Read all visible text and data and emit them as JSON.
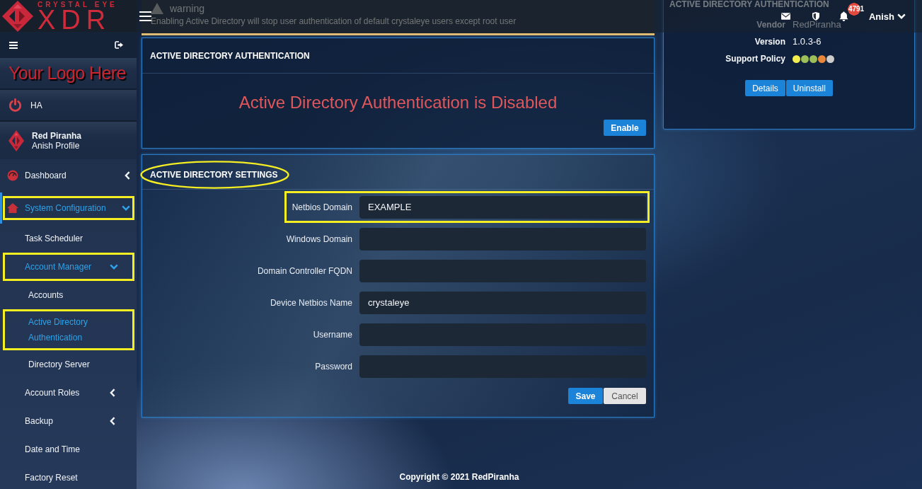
{
  "logo": {
    "tagline": "CRYSTAL EYE",
    "wordmark": "XDR"
  },
  "header": {
    "notification_count": "4791",
    "user": "Anish"
  },
  "sidebar": {
    "custom_logo": "Your Logo Here",
    "ha_label": "HA",
    "profile": {
      "name": "Red Piranha",
      "subtitle": "Anish Profile"
    },
    "items": [
      {
        "label": "Dashboard",
        "selected": false,
        "highlighted": false,
        "expanded": false
      },
      {
        "label": "System Configuration",
        "selected": true,
        "highlighted": true,
        "expanded": true,
        "children": [
          {
            "label": "Task Scheduler",
            "selected": false,
            "highlighted": false
          },
          {
            "label": "Account Manager",
            "selected": true,
            "highlighted": true,
            "expanded": true,
            "children": [
              {
                "label": "Accounts",
                "selected": false,
                "highlighted": false
              },
              {
                "label": "Active Directory Authentication",
                "selected": true,
                "highlighted": true
              },
              {
                "label": "Directory Server",
                "selected": false,
                "highlighted": false
              }
            ]
          },
          {
            "label": "Account Roles",
            "selected": false,
            "highlighted": false,
            "expanded": false
          },
          {
            "label": "Backup",
            "selected": false,
            "highlighted": false,
            "expanded": false
          },
          {
            "label": "Date and Time",
            "selected": false,
            "highlighted": false
          },
          {
            "label": "Factory Reset",
            "selected": false,
            "highlighted": false
          }
        ]
      }
    ]
  },
  "alert": {
    "title": "warning",
    "message": "Enabling Active Directory will stop user authentication of default crystaleye users except root user"
  },
  "status_panel": {
    "title": "ACTIVE DIRECTORY AUTHENTICATION",
    "message": "Active Directory Authentication is Disabled",
    "button": "Enable"
  },
  "settings_panel": {
    "title": "ACTIVE DIRECTORY SETTINGS",
    "circled": true,
    "fields": [
      {
        "label": "Netbios Domain",
        "value": "EXAMPLE",
        "highlighted": true
      },
      {
        "label": "Windows Domain",
        "highlighted": false
      },
      {
        "label": "Domain Controller FQDN",
        "highlighted": false
      },
      {
        "label": "Device Netbios Name",
        "value": "crystaleye",
        "highlighted": false
      },
      {
        "label": "Username",
        "highlighted": false
      },
      {
        "label": "Password",
        "highlighted": false
      }
    ],
    "buttons": [
      {
        "label": "Save",
        "kind": "primary"
      },
      {
        "label": "Cancel",
        "kind": "secondary"
      }
    ]
  },
  "app_card": {
    "title": "ACTIVE DIRECTORY AUTHENTICATION",
    "details": [
      {
        "label": "Vendor",
        "value": "RedPiranha"
      },
      {
        "label": "Version",
        "value": "1.0.3-6"
      }
    ],
    "support_policy": {
      "label": "Support Policy",
      "dots": [
        {
          "color": "#f2ee4e"
        },
        {
          "color": "#9cbf5a"
        },
        {
          "color": "#9cbf5a"
        },
        {
          "color": "#e8873a"
        },
        {
          "color": "#cccccc"
        }
      ]
    },
    "buttons": [
      "Details",
      "Uninstall"
    ]
  },
  "footer": "Copyright © 2021 RedPiranha"
}
